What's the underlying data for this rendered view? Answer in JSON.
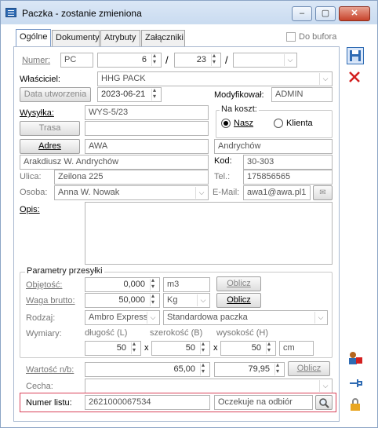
{
  "window": {
    "title": "Paczka - zostanie zmieniona",
    "buttons": {
      "minimize": "‒",
      "maximize": "▢",
      "close": "✕"
    }
  },
  "tabs": [
    {
      "label": "Ogólne"
    },
    {
      "label": "Dokumenty"
    },
    {
      "label": "Atrybuty"
    },
    {
      "label": "Załączniki"
    }
  ],
  "do_bufora": {
    "label": "Do bufora",
    "checked": false
  },
  "numer": {
    "label": "Numer:",
    "prefix": "PC",
    "num": "6",
    "sep1": "/",
    "month": "23",
    "sep2": "/",
    "suffix": ""
  },
  "wlasciciel": {
    "label": "Właściciel:",
    "value": "HHG PACK"
  },
  "data_utworzenia": {
    "label": "Data utworzenia",
    "value": "2023-06-21"
  },
  "modyfikowal": {
    "label": "Modyfikował:",
    "value": "ADMIN"
  },
  "wysylka": {
    "label": "Wysyłka:",
    "value": "WYS-5/23",
    "value2": ""
  },
  "trasa": {
    "label": "Trasa",
    "value": ""
  },
  "na_koszt": {
    "label": "Na koszt:",
    "options": [
      "Nasz",
      "Klienta"
    ],
    "selected": "Nasz"
  },
  "adres": {
    "label": "Adres",
    "code": "AWA",
    "city": "Andrychów",
    "name": "Arakdiusz W. Andrychów"
  },
  "kod": {
    "label": "Kod:",
    "value": "30-303"
  },
  "ulica": {
    "label": "Ulica:",
    "value": "Zeilona 225"
  },
  "tel": {
    "label": "Tel.:",
    "value": "175856565"
  },
  "osoba": {
    "label": "Osoba:",
    "value": "Anna W. Nowak"
  },
  "email": {
    "label": "E-Mail:",
    "value": "awa1@awa.pl1",
    "icon": "envelope-icon"
  },
  "opis": {
    "label": "Opis:",
    "value": ""
  },
  "parametry": {
    "legend": "Parametry przesyłki",
    "objetosc": {
      "label": "Objętość:",
      "value": "0,000",
      "unit": "m3",
      "button": "Oblicz"
    },
    "waga": {
      "label": "Waga brutto:",
      "value": "50,000",
      "unit": "Kg",
      "button": "Oblicz"
    },
    "rodzaj": {
      "label": "Rodzaj:",
      "carrier": "Ambro Express",
      "type": "Standardowa paczka"
    },
    "wymiary": {
      "label": "Wymiary:",
      "dlugosc_label": "długość (L)",
      "szerokosc_label": "szerokość (B)",
      "wysokosc_label": "wysokość (H)",
      "dlugosc": "50",
      "szerokosc": "50",
      "wysokosc": "50",
      "x": "x",
      "unit": "cm"
    }
  },
  "wartosc": {
    "label": "Wartość n/b:",
    "value1": "65,00",
    "value2": "79,95",
    "button": "Oblicz"
  },
  "cecha": {
    "label": "Cecha:",
    "value": ""
  },
  "numer_listu": {
    "label": "Numer listu:",
    "value": "2621000067534",
    "status": "Oczekuje na odbiór"
  },
  "colors": {
    "highlight": "#d9435a",
    "accent": "#2f6bb3"
  }
}
